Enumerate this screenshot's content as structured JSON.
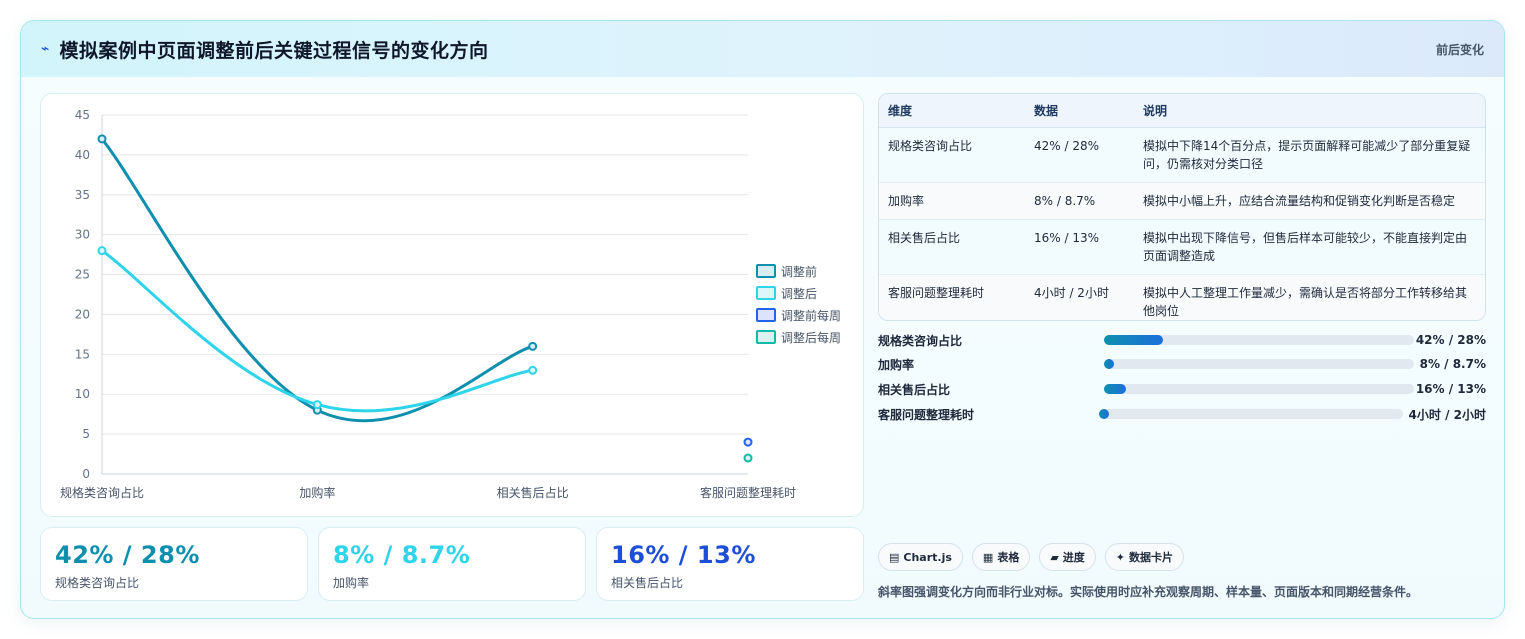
{
  "header": {
    "logo": "⌁",
    "title": "模拟案例中页面调整前后关键过程信号的变化方向",
    "tag": "前后变化"
  },
  "chart_data": {
    "type": "line",
    "categories": [
      "规格类咨询占比",
      "加购率",
      "相关售后占比",
      "客服问题整理耗时"
    ],
    "ylim": [
      0,
      45
    ],
    "yticks": [
      0,
      5,
      10,
      15,
      20,
      25,
      30,
      35,
      40,
      45
    ],
    "grid": true,
    "legend_position": "right",
    "series": [
      {
        "name": "调整前",
        "values": [
          42,
          8,
          16,
          null
        ],
        "color": "#0e8fae",
        "fill": "#d6eef3"
      },
      {
        "name": "调整后",
        "values": [
          28,
          8.7,
          13,
          null
        ],
        "color": "#2dd4ea",
        "fill": "#ddf6fb"
      },
      {
        "name": "调整前每周",
        "values": [
          null,
          null,
          null,
          4
        ],
        "color": "#2563eb",
        "fill": "#dbe4fb"
      },
      {
        "name": "调整后每周",
        "values": [
          null,
          null,
          null,
          2
        ],
        "color": "#14b8a6",
        "fill": "#d8f3ef"
      }
    ]
  },
  "kpis": [
    {
      "value": "42% / 28%",
      "label": "规格类咨询占比",
      "color": "#0e8fae"
    },
    {
      "value": "8% / 8.7%",
      "label": "加购率",
      "color": "#2dd4ea"
    },
    {
      "value": "16% / 13%",
      "label": "相关售后占比",
      "color": "#1d4ed8"
    }
  ],
  "table": {
    "headers": [
      "维度",
      "数据",
      "说明"
    ],
    "rows": [
      [
        "规格类咨询占比",
        "42% / 28%",
        "模拟中下降14个百分点，提示页面解释可能减少了部分重复疑问，仍需核对分类口径"
      ],
      [
        "加购率",
        "8% / 8.7%",
        "模拟中小幅上升，应结合流量结构和促销变化判断是否稳定"
      ],
      [
        "相关售后占比",
        "16% / 13%",
        "模拟中出现下降信号，但售后样本可能较少，不能直接判定由页面调整造成"
      ],
      [
        "客服问题整理耗时",
        "4小时 / 2小时",
        "模拟中人工整理工作量减少，需确认是否将部分工作转移给其他岗位"
      ]
    ]
  },
  "progress": [
    {
      "label": "规格类咨询占比",
      "value": "42% / 28%",
      "fraction": 0.19
    },
    {
      "label": "加购率",
      "value": "8% / 8.7%",
      "fraction": 0.03
    },
    {
      "label": "相关售后占比",
      "value": "16% / 13%",
      "fraction": 0.07
    },
    {
      "label": "客服问题整理耗时",
      "value": "4小时 / 2小时",
      "fraction": 0.02
    }
  ],
  "pills": [
    {
      "icon": "▤",
      "label": "Chart.js"
    },
    {
      "icon": "▦",
      "label": "表格"
    },
    {
      "icon": "▰",
      "label": "进度"
    },
    {
      "icon": "✦",
      "label": "数据卡片"
    }
  ],
  "note": "斜率图强调变化方向而非行业对标。实际使用时应补充观察周期、样本量、页面版本和同期经营条件。"
}
